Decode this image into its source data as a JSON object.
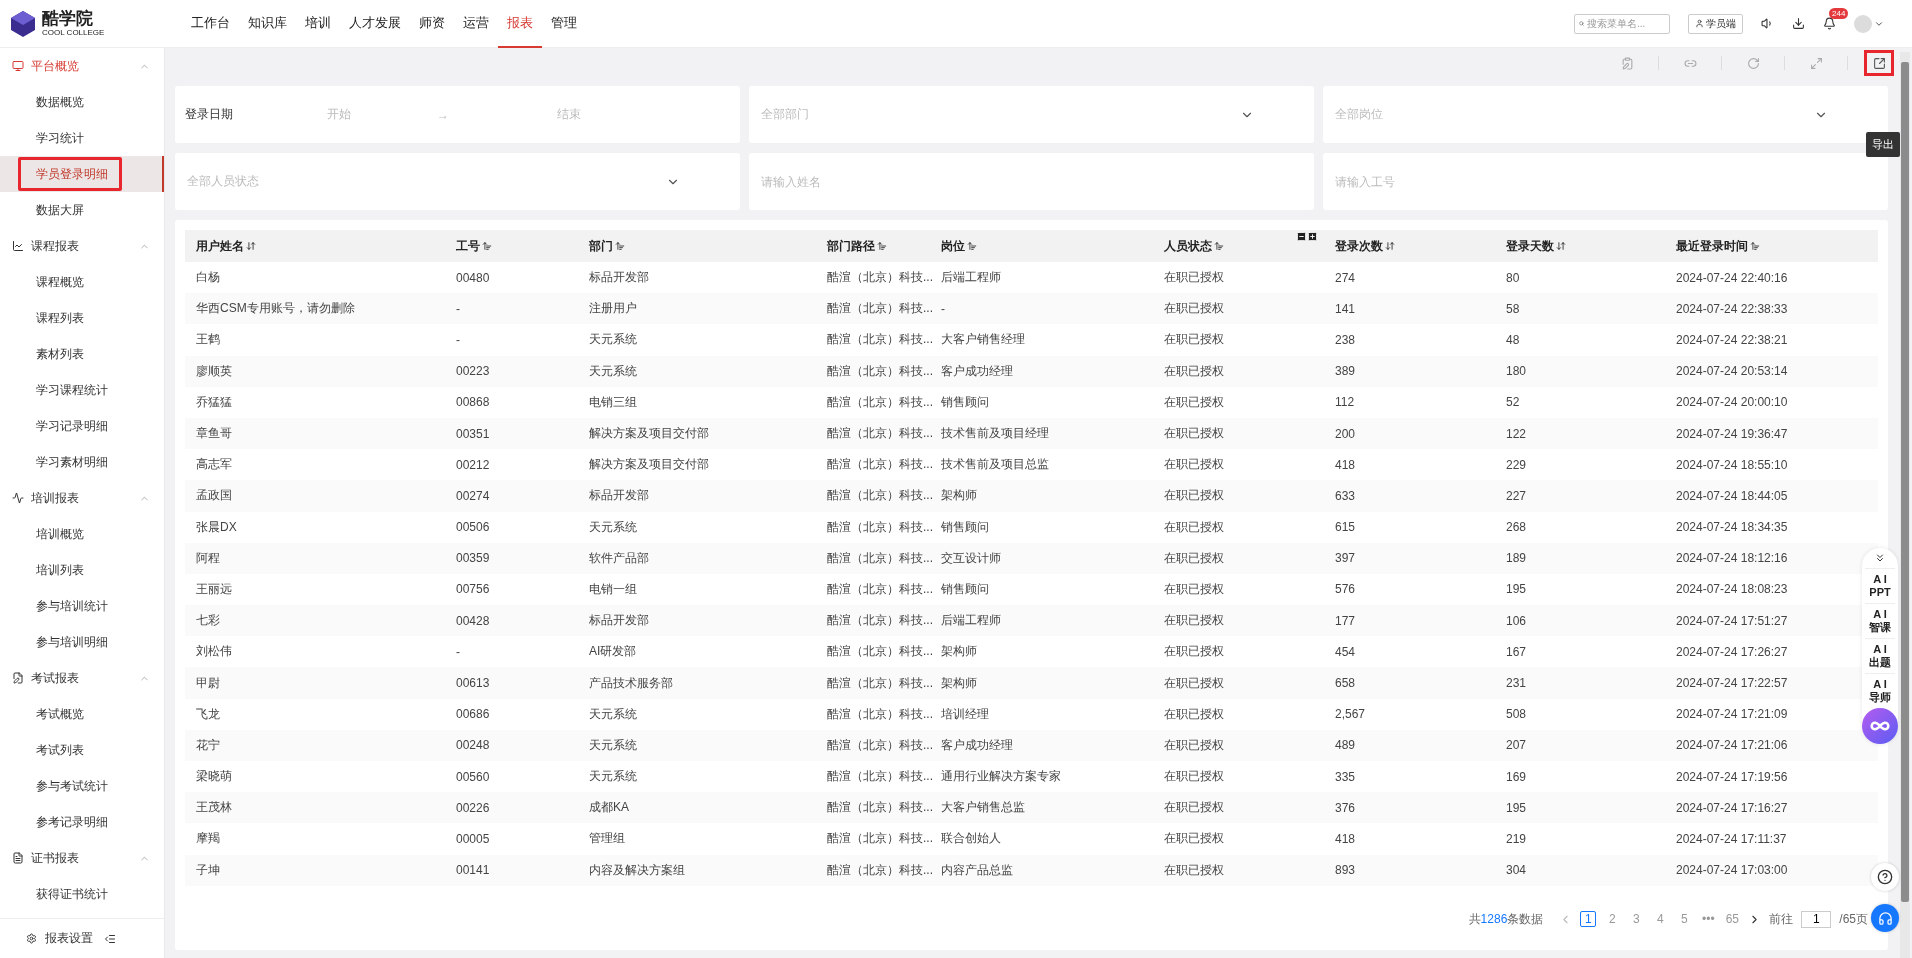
{
  "brand": {
    "name": "酷学院",
    "subtitle": "COOL COLLEGE"
  },
  "nav": [
    {
      "label": "工作台",
      "selected": false
    },
    {
      "label": "知识库",
      "selected": false
    },
    {
      "label": "培训",
      "selected": false
    },
    {
      "label": "人才发展",
      "selected": false
    },
    {
      "label": "师资",
      "selected": false
    },
    {
      "label": "运营",
      "selected": false
    },
    {
      "label": "报表",
      "selected": true
    },
    {
      "label": "管理",
      "selected": false
    }
  ],
  "header": {
    "search_placeholder": "搜索菜单名...",
    "student_button": "学员端",
    "notification_badge": "244"
  },
  "sidebar": {
    "groups": [
      {
        "label": "平台概览",
        "expanded": true,
        "active": true,
        "items": [
          {
            "label": "数据概览",
            "selected": false,
            "outlined": false
          },
          {
            "label": "学习统计",
            "selected": false,
            "outlined": false
          },
          {
            "label": "学员登录明细",
            "selected": true,
            "outlined": true
          },
          {
            "label": "数据大屏",
            "selected": false,
            "outlined": false
          }
        ]
      },
      {
        "label": "课程报表",
        "expanded": true,
        "active": false,
        "items": [
          {
            "label": "课程概览",
            "selected": false,
            "outlined": false
          },
          {
            "label": "课程列表",
            "selected": false,
            "outlined": false
          },
          {
            "label": "素材列表",
            "selected": false,
            "outlined": false
          },
          {
            "label": "学习课程统计",
            "selected": false,
            "outlined": false
          },
          {
            "label": "学习记录明细",
            "selected": false,
            "outlined": false
          },
          {
            "label": "学习素材明细",
            "selected": false,
            "outlined": false
          }
        ]
      },
      {
        "label": "培训报表",
        "expanded": true,
        "active": false,
        "items": [
          {
            "label": "培训概览",
            "selected": false,
            "outlined": false
          },
          {
            "label": "培训列表",
            "selected": false,
            "outlined": false
          },
          {
            "label": "参与培训统计",
            "selected": false,
            "outlined": false
          },
          {
            "label": "参与培训明细",
            "selected": false,
            "outlined": false
          }
        ]
      },
      {
        "label": "考试报表",
        "expanded": true,
        "active": false,
        "items": [
          {
            "label": "考试概览",
            "selected": false,
            "outlined": false
          },
          {
            "label": "考试列表",
            "selected": false,
            "outlined": false
          },
          {
            "label": "参与考试统计",
            "selected": false,
            "outlined": false
          },
          {
            "label": "参考记录明细",
            "selected": false,
            "outlined": false
          }
        ]
      },
      {
        "label": "证书报表",
        "expanded": true,
        "active": false,
        "items": [
          {
            "label": "获得证书统计",
            "selected": false,
            "outlined": false
          }
        ]
      }
    ],
    "footer": "报表设置"
  },
  "toolbar": {
    "export_outlined": true,
    "tooltip": "导出"
  },
  "filters": {
    "date_label": "登录日期",
    "date_start": "开始",
    "date_arrow": "→",
    "date_end": "结束",
    "department": "全部部门",
    "position": "全部岗位",
    "status": "全部人员状态",
    "name_placeholder": "请输入姓名",
    "id_placeholder": "请输入工号"
  },
  "table": {
    "columns": [
      "用户姓名",
      "工号",
      "部门",
      "部门路径",
      "岗位",
      "人员状态",
      "登录次数",
      "登录天数",
      "最近登录时间"
    ],
    "rows": [
      [
        "白杨",
        "00480",
        "标品开发部",
        "酷渲（北京）科技...",
        "后端工程师",
        "在职已授权",
        "274",
        "80",
        "2024-07-24 22:40:16"
      ],
      [
        "华西CSM专用账号，请勿删除",
        "-",
        "注册用户",
        "酷渲（北京）科技...",
        "-",
        "在职已授权",
        "141",
        "58",
        "2024-07-24 22:38:33"
      ],
      [
        "王鹤",
        "-",
        "天元系统",
        "酷渲（北京）科技...",
        "大客户销售经理",
        "在职已授权",
        "238",
        "48",
        "2024-07-24 22:38:21"
      ],
      [
        "廖顺英",
        "00223",
        "天元系统",
        "酷渲（北京）科技...",
        "客户成功经理",
        "在职已授权",
        "389",
        "180",
        "2024-07-24 20:53:14"
      ],
      [
        "乔猛猛",
        "00868",
        "电销三组",
        "酷渲（北京）科技...",
        "销售顾问",
        "在职已授权",
        "112",
        "52",
        "2024-07-24 20:00:10"
      ],
      [
        "章鱼哥",
        "00351",
        "解决方案及项目交付部",
        "酷渲（北京）科技...",
        "技术售前及项目经理",
        "在职已授权",
        "200",
        "122",
        "2024-07-24 19:36:47"
      ],
      [
        "高志军",
        "00212",
        "解决方案及项目交付部",
        "酷渲（北京）科技...",
        "技术售前及项目总监",
        "在职已授权",
        "418",
        "229",
        "2024-07-24 18:55:10"
      ],
      [
        "孟政国",
        "00274",
        "标品开发部",
        "酷渲（北京）科技...",
        "架构师",
        "在职已授权",
        "633",
        "227",
        "2024-07-24 18:44:05"
      ],
      [
        "张晨DX",
        "00506",
        "天元系统",
        "酷渲（北京）科技...",
        "销售顾问",
        "在职已授权",
        "615",
        "268",
        "2024-07-24 18:34:35"
      ],
      [
        "阿程",
        "00359",
        "软件产品部",
        "酷渲（北京）科技...",
        "交互设计师",
        "在职已授权",
        "397",
        "189",
        "2024-07-24 18:12:16"
      ],
      [
        "王丽远",
        "00756",
        "电销一组",
        "酷渲（北京）科技...",
        "销售顾问",
        "在职已授权",
        "576",
        "195",
        "2024-07-24 18:08:23"
      ],
      [
        "七彩",
        "00428",
        "标品开发部",
        "酷渲（北京）科技...",
        "后端工程师",
        "在职已授权",
        "177",
        "106",
        "2024-07-24 17:51:27"
      ],
      [
        "刘松伟",
        "-",
        "AI研发部",
        "酷渲（北京）科技...",
        "架构师",
        "在职已授权",
        "454",
        "167",
        "2024-07-24 17:26:27"
      ],
      [
        "甲尉",
        "00613",
        "产品技术服务部",
        "酷渲（北京）科技...",
        "架构师",
        "在职已授权",
        "658",
        "231",
        "2024-07-24 17:22:57"
      ],
      [
        "飞龙",
        "00686",
        "天元系统",
        "酷渲（北京）科技...",
        "培训经理",
        "在职已授权",
        "2,567",
        "508",
        "2024-07-24 17:21:09"
      ],
      [
        "花宁",
        "00248",
        "天元系统",
        "酷渲（北京）科技...",
        "客户成功经理",
        "在职已授权",
        "489",
        "207",
        "2024-07-24 17:21:06"
      ],
      [
        "梁晓萌",
        "00560",
        "天元系统",
        "酷渲（北京）科技...",
        "通用行业解决方案专家",
        "在职已授权",
        "335",
        "169",
        "2024-07-24 17:19:56"
      ],
      [
        "王茂林",
        "00226",
        "成都KA",
        "酷渲（北京）科技...",
        "大客户销售总监",
        "在职已授权",
        "376",
        "195",
        "2024-07-24 17:16:27"
      ],
      [
        "摩羯",
        "00005",
        "管理组",
        "酷渲（北京）科技...",
        "联合创始人",
        "在职已授权",
        "418",
        "219",
        "2024-07-24 17:11:37"
      ],
      [
        "子坤",
        "00141",
        "内容及解决方案组",
        "酷渲（北京）科技...",
        "内容产品总监",
        "在职已授权",
        "893",
        "304",
        "2024-07-24 17:03:00"
      ]
    ]
  },
  "pagination": {
    "total_prefix": "共",
    "total_count": "1286",
    "total_suffix": "条数据",
    "pages": [
      {
        "label": "1",
        "selected": true
      },
      {
        "label": "2",
        "selected": false
      },
      {
        "label": "3",
        "selected": false
      },
      {
        "label": "4",
        "selected": false
      },
      {
        "label": "5",
        "selected": false
      },
      {
        "label": "•••",
        "selected": false
      },
      {
        "label": "65",
        "selected": false
      }
    ],
    "goto_label": "前往",
    "goto_value": "1",
    "page_total": "/65页"
  },
  "ai_panel": [
    {
      "top": "A I",
      "bottom": "PPT"
    },
    {
      "top": "A I",
      "bottom": "智课"
    },
    {
      "top": "A I",
      "bottom": "出题"
    },
    {
      "top": "A I",
      "bottom": "导师"
    }
  ]
}
